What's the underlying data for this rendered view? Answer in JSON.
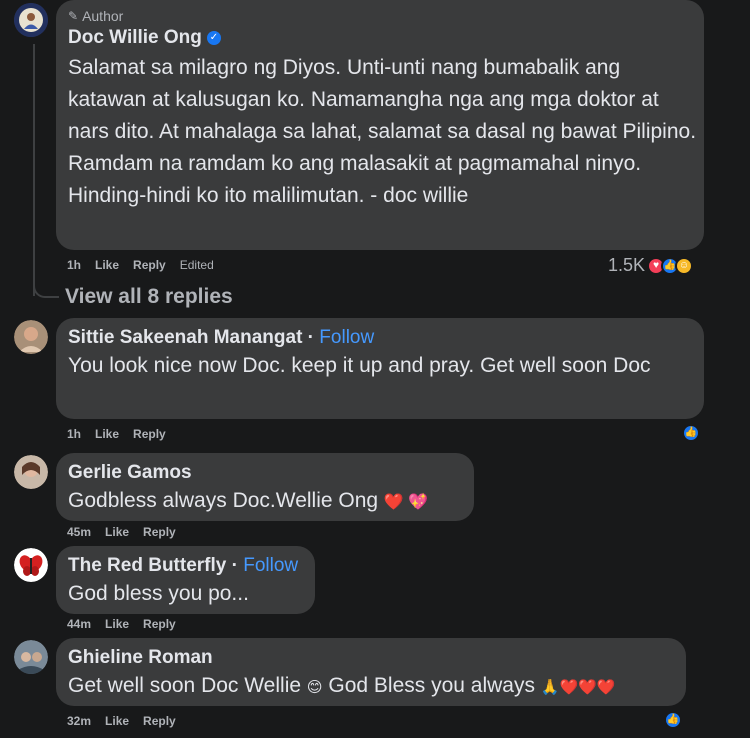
{
  "comments": [
    {
      "badge": "Author",
      "name": "Doc Willie Ong",
      "text": "Salamat sa milagro ng Diyos. Unti-unti nang bumabalik ang katawan at kalusugan ko. Namamangha nga ang mga doktor at nars dito. At mahalaga sa lahat, salamat sa dasal ng bawat Pilipino. Ramdam na ramdam ko ang malasakit at pagmamahal ninyo. Hinding-hindi ko ito malilimutan. - doc willie",
      "time": "1h",
      "like": "Like",
      "reply": "Reply",
      "edited": "Edited",
      "reaction_count": "1.5K",
      "view_replies": "View all 8 replies"
    },
    {
      "name": "Sittie Sakeenah Manangat",
      "follow": "Follow",
      "text": "You look nice now Doc. keep it up and pray. Get well soon Doc",
      "time": "1h",
      "like": "Like",
      "reply": "Reply"
    },
    {
      "name": "Gerlie Gamos",
      "text": "Godbless always Doc.Wellie Ong",
      "emoji": "❤️ 💖",
      "time": "45m",
      "like": "Like",
      "reply": "Reply"
    },
    {
      "name": "The Red Butterfly",
      "follow": "Follow",
      "text": "God bless you po...",
      "time": "44m",
      "like": "Like",
      "reply": "Reply"
    },
    {
      "name": "Ghieline Roman",
      "text": "Get well soon Doc Wellie",
      "emoji1": "😊",
      "text2": "God Bless you always",
      "emoji2": "🙏❤️❤️❤️",
      "time": "32m",
      "like": "Like",
      "reply": "Reply"
    }
  ],
  "colors": {
    "background": "#18191a",
    "bubble": "#3a3b3c",
    "link": "#4599ff",
    "meta": "#b0b3b8",
    "like_blue": "#1877f2",
    "love_red": "#f33e58"
  }
}
